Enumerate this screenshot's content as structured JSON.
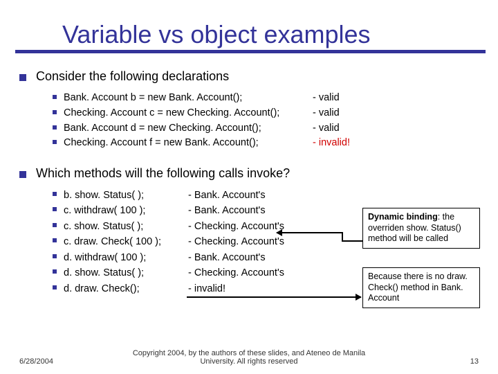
{
  "title": "Variable vs object examples",
  "section1": {
    "lead": "Consider the following declarations",
    "items": [
      {
        "code": "Bank. Account b = new Bank. Account();",
        "status": "- valid",
        "invalid": false
      },
      {
        "code": "Checking. Account c = new Checking. Account();",
        "status": "- valid",
        "invalid": false
      },
      {
        "code": "Bank. Account d = new Checking. Account();",
        "status": "- valid",
        "invalid": false
      },
      {
        "code": "Checking. Account f = new Bank. Account();",
        "status": "- invalid!",
        "invalid": true
      }
    ]
  },
  "section2": {
    "lead": "Which methods will the following calls invoke?",
    "items": [
      {
        "code": "b. show. Status( );",
        "owner": "- Bank. Account's"
      },
      {
        "code": "c. withdraw( 100 );",
        "owner": "- Bank. Account's"
      },
      {
        "code": "c. show. Status( );",
        "owner": "- Checking. Account's"
      },
      {
        "code": "c. draw. Check( 100 );",
        "owner": "- Checking. Account's"
      },
      {
        "code": "d. withdraw( 100 );",
        "owner": "- Bank. Account's"
      },
      {
        "code": "d. show. Status( );",
        "owner": "- Checking. Account's"
      },
      {
        "code": "d. draw. Check();",
        "owner": "- invalid!",
        "invalid": true
      }
    ]
  },
  "notes": {
    "n1_bold": "Dynamic binding",
    "n1_rest": ": the overriden show. Status() method will be called",
    "n2": "Because there is no draw. Check() method in Bank. Account"
  },
  "footer": {
    "date": "6/28/2004",
    "copyright": "Copyright 2004, by the authors of these slides, and Ateneo de Manila University. All rights reserved",
    "page": "13"
  }
}
